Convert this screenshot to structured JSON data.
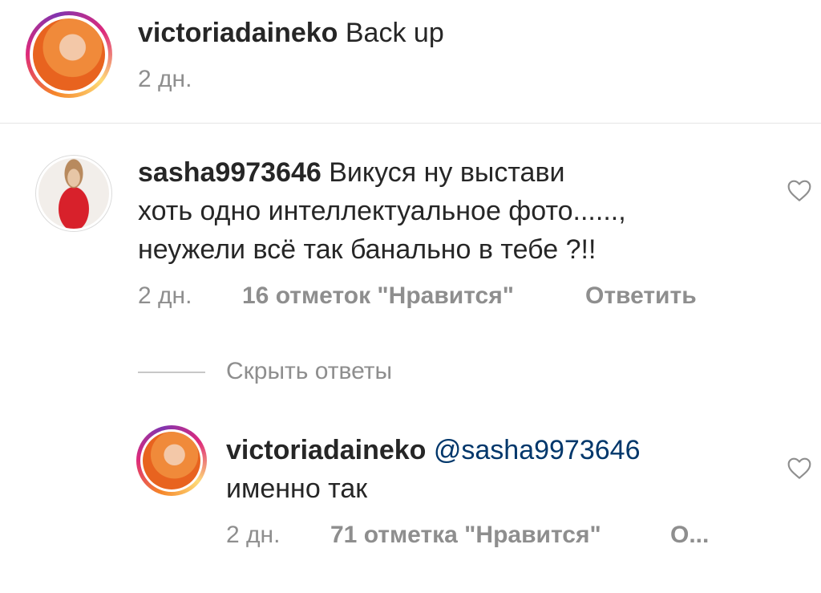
{
  "caption": {
    "username": "victoriadaineko",
    "text": "Back up",
    "time": "2 дн."
  },
  "comment1": {
    "username": "sasha9973646",
    "text_line1": "Викуся ну выстави",
    "text_line2": "хоть одно интеллектуальное фото......,",
    "text_line3": "неужели всё так банально в тебе ?!!",
    "time": "2 дн.",
    "likes": "16 отметок \"Нравится\"",
    "reply": "Ответить"
  },
  "replies_toggle": {
    "label": "Скрыть ответы"
  },
  "reply1": {
    "username": "victoriadaineko",
    "mention": "@sasha9973646",
    "text": "именно так",
    "time": "2 дн.",
    "likes": "71 отметка \"Нравится\"",
    "reply": "О..."
  },
  "icons": {
    "like": "heart-outline-icon"
  },
  "colors": {
    "text": "#262626",
    "secondary": "#8e8e8e",
    "mention": "#00376b"
  }
}
